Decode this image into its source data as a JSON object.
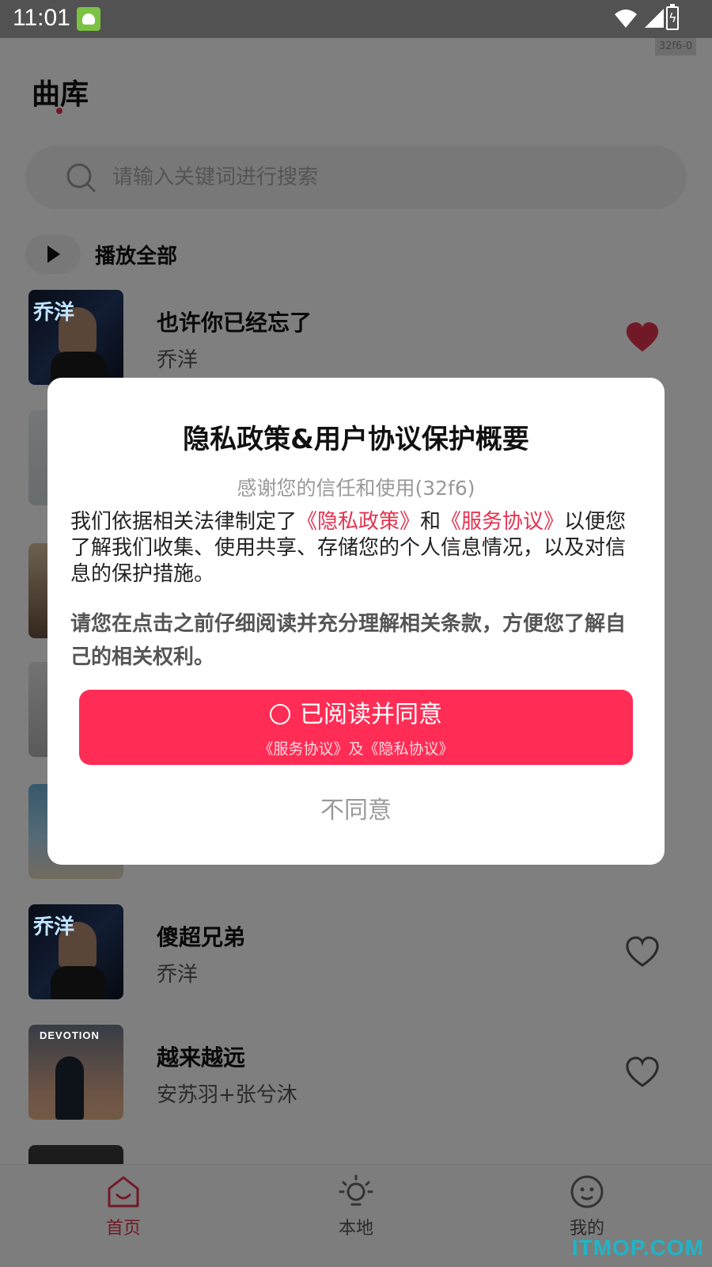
{
  "status_bar": {
    "time": "11:01",
    "debug_tag": "32f6-0"
  },
  "header": {
    "title": "曲库"
  },
  "search": {
    "placeholder": "请输入关键词进行搜索"
  },
  "play_all": {
    "label": "播放全部"
  },
  "songs": [
    {
      "title": "也许你已经忘了",
      "artist": "乔洋",
      "favorited": true,
      "cover_text": "乔洋"
    },
    {
      "title": "",
      "artist": "",
      "favorited": false
    },
    {
      "title": "",
      "artist": "",
      "favorited": false
    },
    {
      "title": "",
      "artist": "",
      "favorited": false
    },
    {
      "title": "",
      "artist": "",
      "favorited": false
    },
    {
      "title": "傻超兄弟",
      "artist": "乔洋",
      "favorited": false,
      "cover_text": "乔洋"
    },
    {
      "title": "越来越远",
      "artist": "安苏羽+张兮沐",
      "favorited": false,
      "cover_text": "DEVOTION"
    }
  ],
  "dialog": {
    "title": "隐私政策&用户协议保护概要",
    "subtitle": "感谢您的信任和使用(32f6)",
    "body_prefix": "我们依据相关法律制定了",
    "privacy_link": "《隐私政策》",
    "and_text": "和",
    "service_link": "《服务协议》",
    "body_suffix": "以便您了解我们收集、使用共享、存储您的个人信息情况，以及对信息的保护措施。",
    "note": "请您在点击之前仔细阅读并充分理解相关条款，方便您了解自己的相关权利。",
    "agree_label": "已阅读并同意",
    "agree_sub": "《服务协议》及《隐私协议》",
    "disagree_label": "不同意"
  },
  "bottom_nav": [
    {
      "label": "首页",
      "icon": "home-icon",
      "active": true
    },
    {
      "label": "本地",
      "icon": "lightbulb-icon",
      "active": false
    },
    {
      "label": "我的",
      "icon": "smiley-icon",
      "active": false
    }
  ],
  "watermark": "ITMOP.COM",
  "colors": {
    "accent": "#ff2d55",
    "link": "#e53250",
    "heart_filled": "#e53250",
    "overlay": "rgba(0,0,0,0.5)"
  }
}
